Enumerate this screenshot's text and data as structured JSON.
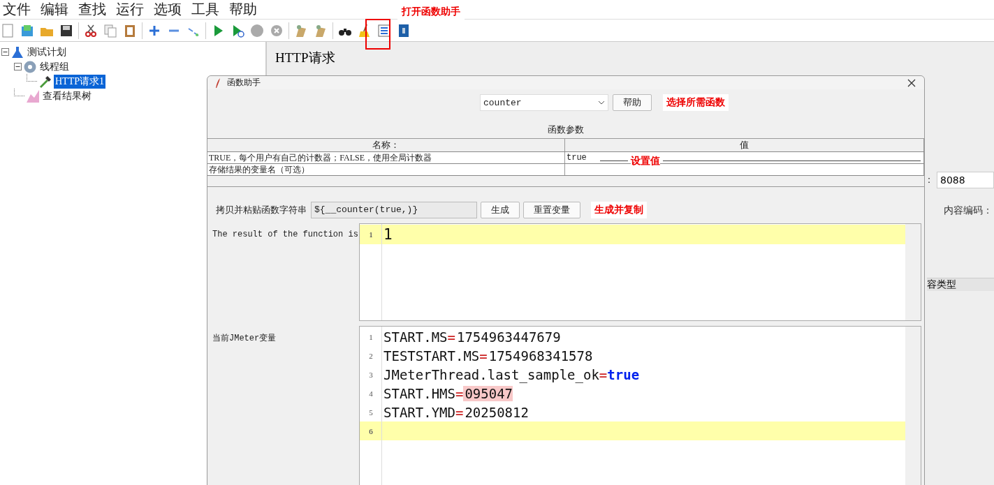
{
  "menu": [
    "文件",
    "编辑",
    "查找",
    "运行",
    "选项",
    "工具",
    "帮助"
  ],
  "tree": [
    {
      "label": "测试计划",
      "expanded": true,
      "selected": false,
      "children": [
        {
          "label": "线程组",
          "expanded": true,
          "selected": false,
          "children": [
            {
              "label": "HTTP请求1",
              "selected": true
            }
          ]
        },
        {
          "label": "查看结果树",
          "selected": false
        }
      ]
    }
  ],
  "panel": {
    "title": "HTTP请求",
    "port_label": "：",
    "port": "8088",
    "encoding_label": "内容编码：",
    "column_label": "容类型"
  },
  "dialog": {
    "title": "函数助手",
    "function": "counter",
    "help_button": "帮助",
    "params_title": "函数参数",
    "columns": [
      "名称：",
      "值"
    ],
    "params": [
      {
        "name": "TRUE，每个用户有自己的计数器；FALSE，使用全局计数器",
        "value": "true"
      },
      {
        "name": "存储结果的变量名（可选）"
      }
    ],
    "string_label": "拷贝并粘贴函数字符串",
    "string_value": "${__counter(true,)}",
    "buttons": [
      "生成",
      "重置变量"
    ],
    "result_label": "The result of the function is",
    "result_lines": [
      {
        "number": "1",
        "value": "1",
        "current": true
      }
    ],
    "vars_label": "当前JMeter变量",
    "var_lines": [
      {
        "number": "1",
        "key": "START.MS",
        "sign": "=",
        "value": "1754963447679",
        "kind": "number",
        "highlighted": false,
        "current": false
      },
      {
        "number": "2",
        "key": "TESTSTART.MS",
        "sign": "=",
        "value": "1754968341578",
        "kind": "number",
        "highlighted": false,
        "current": false
      },
      {
        "number": "3",
        "key": "JMeterThread.last_sample_ok",
        "sign": "=",
        "value": "true",
        "kind": "keyword",
        "highlighted": false,
        "current": false
      },
      {
        "number": "4",
        "key": "START.HMS",
        "sign": "=",
        "value": "095047",
        "kind": "number",
        "highlighted": true,
        "current": false
      },
      {
        "number": "5",
        "key": "START.YMD",
        "sign": "=",
        "value": "20250812",
        "kind": "number",
        "highlighted": false,
        "current": false
      },
      {
        "number": "6",
        "current": true
      }
    ]
  },
  "annotations": {
    "open_helper": "打开函数助手",
    "choose_function": "选择所需函数",
    "set_value": "设置值",
    "generate_copy": "生成并复制"
  }
}
